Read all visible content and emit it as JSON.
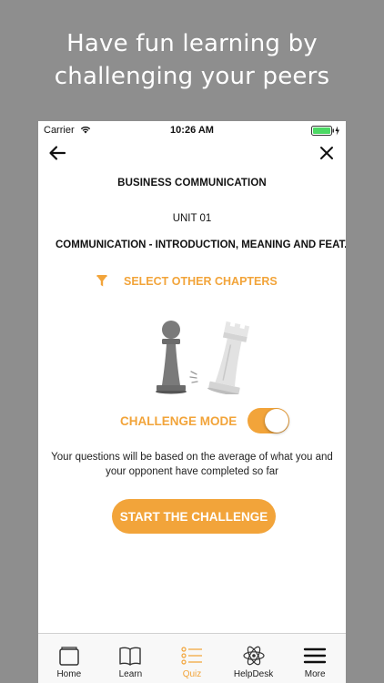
{
  "promo": {
    "line1": "Have fun learning by",
    "line2": "challenging your peers"
  },
  "status_bar": {
    "carrier": "Carrier",
    "time": "10:26 AM"
  },
  "header": {
    "course_title": "BUSINESS COMMUNICATION",
    "unit_label": "UNIT 01",
    "chapter_title": "COMMUNICATION - INTRODUCTION, MEANING AND FEAT..."
  },
  "chapter_filter": {
    "label": "SELECT OTHER CHAPTERS",
    "icon": "filter-icon"
  },
  "challenge": {
    "mode_label": "CHALLENGE MODE",
    "toggle_on": true,
    "description": "Your questions will be based on the average of what you and your opponent have completed so far",
    "start_button": "START THE CHALLENGE"
  },
  "tabs": [
    {
      "label": "Home",
      "icon": "home-icon",
      "active": false
    },
    {
      "label": "Learn",
      "icon": "book-icon",
      "active": false
    },
    {
      "label": "Quiz",
      "icon": "list-icon",
      "active": true
    },
    {
      "label": "HelpDesk",
      "icon": "atom-icon",
      "active": false
    },
    {
      "label": "More",
      "icon": "menu-icon",
      "active": false
    }
  ],
  "colors": {
    "accent": "#f2a43a",
    "background": "#8e8e8e",
    "battery": "#4cd964"
  }
}
